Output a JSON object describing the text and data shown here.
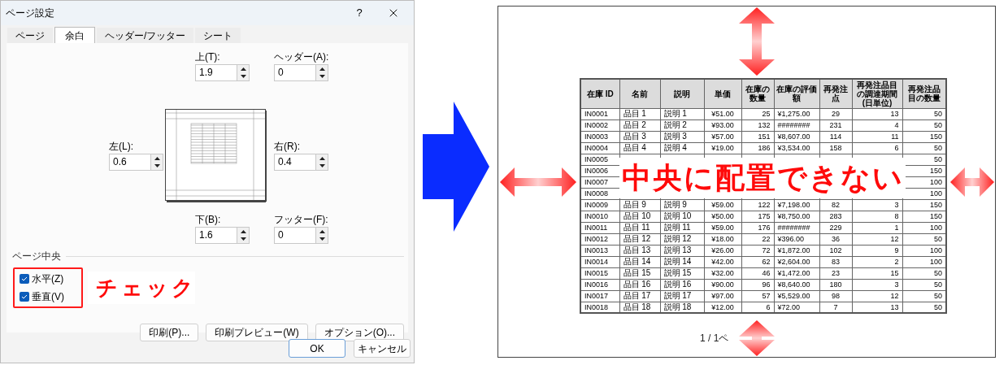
{
  "dialog": {
    "title": "ページ設定",
    "help": "?",
    "tabs": [
      {
        "label": "ページ",
        "selected": false
      },
      {
        "label": "余白",
        "selected": true
      },
      {
        "label": "ヘッダー/フッター",
        "selected": false
      },
      {
        "label": "シート",
        "selected": false
      }
    ],
    "margins": {
      "top": {
        "label": "上(T):",
        "value": "1.9"
      },
      "header": {
        "label": "ヘッダー(A):",
        "value": "0"
      },
      "left": {
        "label": "左(L):",
        "value": "0.6"
      },
      "right": {
        "label": "右(R):",
        "value": "0.4"
      },
      "bottom": {
        "label": "下(B):",
        "value": "1.6"
      },
      "footer": {
        "label": "フッター(F):",
        "value": "0"
      }
    },
    "center": {
      "legend": "ページ中央",
      "options": [
        {
          "label": "水平(Z)",
          "checked": true
        },
        {
          "label": "垂直(V)",
          "checked": true
        }
      ]
    },
    "annotation": "チェック",
    "buttons": [
      "印刷(P)...",
      "印刷プレビュー(W)",
      "オプション(O)..."
    ],
    "footer_buttons": [
      {
        "label": "OK",
        "default": true
      },
      {
        "label": "キャンセル",
        "default": false
      }
    ]
  },
  "print_preview": {
    "table": {
      "columns": [
        "在庫 ID",
        "名前",
        "説明",
        "単価",
        "在庫の数量",
        "在庫の評価額",
        "再発注点",
        "再発注品目の調達期間 (日単位)",
        "再発注品目の数量"
      ],
      "rows": [
        {
          "cells": [
            "IN0001",
            "品目 1",
            "説明 1",
            "¥51.00",
            "25",
            "¥1,275.00",
            "29",
            "13",
            "50"
          ]
        },
        {
          "cells": [
            "IN0002",
            "品目 2",
            "説明 2",
            "¥93.00",
            "132",
            "########",
            "231",
            "4",
            "50"
          ]
        },
        {
          "cells": [
            "IN0003",
            "品目 3",
            "説明 3",
            "¥57.00",
            "151",
            "¥8,607.00",
            "114",
            "11",
            "150"
          ]
        },
        {
          "cells": [
            "IN0004",
            "品目 4",
            "説明 4",
            "¥19.00",
            "186",
            "¥3,534.00",
            "158",
            "6",
            "50"
          ]
        },
        {
          "cells": [
            "IN0005",
            "50"
          ]
        },
        {
          "cells": [
            "IN0006",
            "150"
          ]
        },
        {
          "cells": [
            "IN0007",
            "100"
          ]
        },
        {
          "cells": [
            "IN0008",
            "100"
          ]
        },
        {
          "cells": [
            "IN0009",
            "品目 9",
            "説明 9",
            "¥59.00",
            "122",
            "¥7,198.00",
            "82",
            "3",
            "150"
          ]
        },
        {
          "cells": [
            "IN0010",
            "品目 10",
            "説明 10",
            "¥50.00",
            "175",
            "¥8,750.00",
            "283",
            "8",
            "150"
          ]
        },
        {
          "cells": [
            "IN0011",
            "品目 11",
            "説明 11",
            "¥59.00",
            "176",
            "########",
            "229",
            "1",
            "100"
          ]
        },
        {
          "cells": [
            "IN0012",
            "品目 12",
            "説明 12",
            "¥18.00",
            "22",
            "¥396.00",
            "36",
            "12",
            "50"
          ]
        },
        {
          "cells": [
            "IN0013",
            "品目 13",
            "説明 13",
            "¥26.00",
            "72",
            "¥1,872.00",
            "102",
            "9",
            "100"
          ]
        },
        {
          "cells": [
            "IN0014",
            "品目 14",
            "説明 14",
            "¥42.00",
            "62",
            "¥2,604.00",
            "83",
            "2",
            "100"
          ]
        },
        {
          "cells": [
            "IN0015",
            "品目 15",
            "説明 15",
            "¥32.00",
            "46",
            "¥1,472.00",
            "23",
            "15",
            "50"
          ]
        },
        {
          "cells": [
            "IN0016",
            "品目 16",
            "説明 16",
            "¥90.00",
            "96",
            "¥8,640.00",
            "180",
            "3",
            "50"
          ]
        },
        {
          "cells": [
            "IN0017",
            "品目 17",
            "説明 17",
            "¥97.00",
            "57",
            "¥5,529.00",
            "98",
            "12",
            "50"
          ]
        },
        {
          "cells": [
            "IN0018",
            "品目 18",
            "説明 18",
            "¥12.00",
            "6",
            "¥72.00",
            "7",
            "13",
            "50"
          ]
        }
      ]
    },
    "annotation": "中央に配置できない",
    "page_number": "1 / 1ペ"
  }
}
